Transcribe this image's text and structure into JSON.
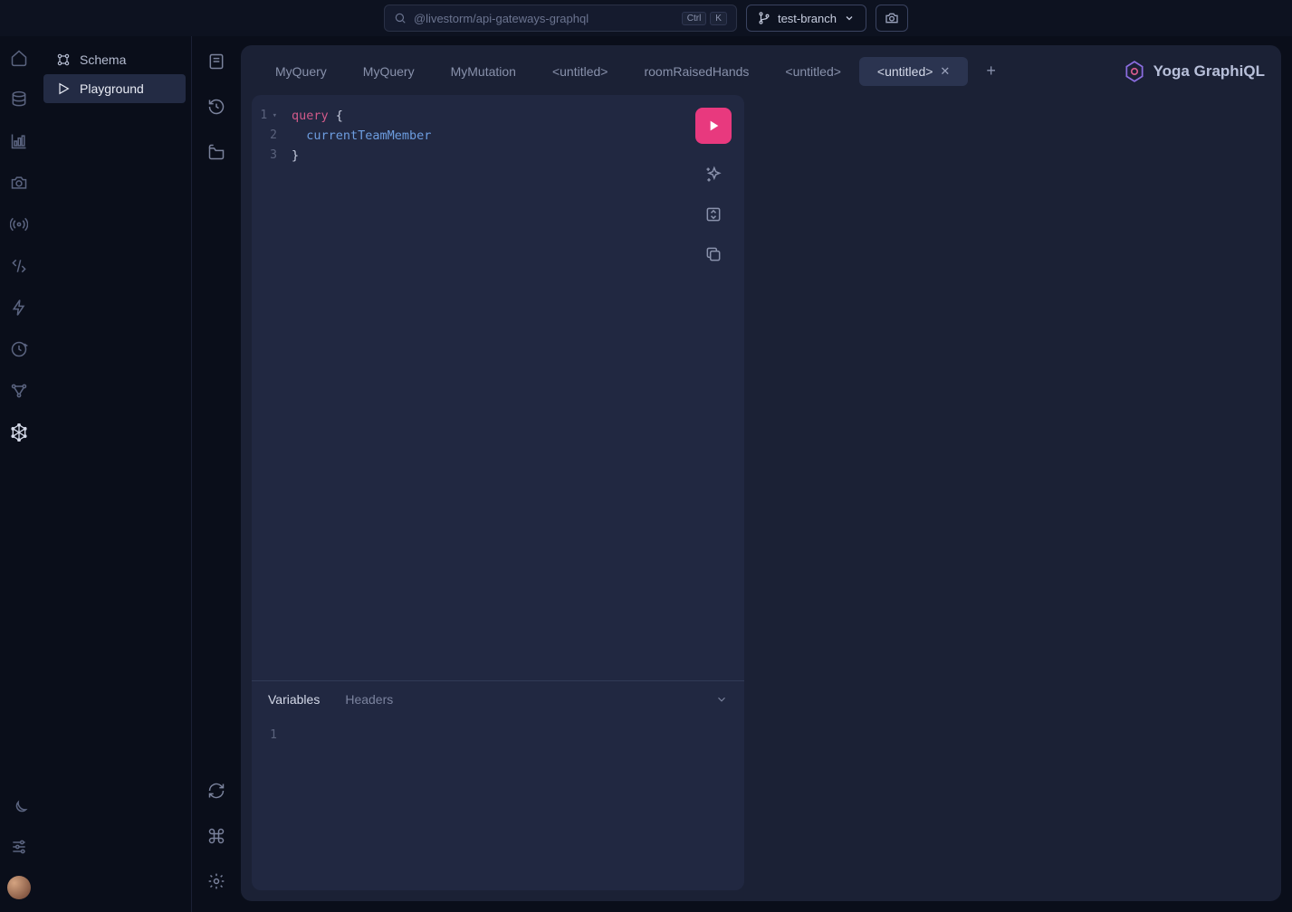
{
  "topbar": {
    "search_text": "@livestorm/api-gateways-graphql",
    "kbd1": "Ctrl",
    "kbd2": "K",
    "branch_label": "test-branch"
  },
  "sidebar2": {
    "items": [
      {
        "label": "Schema"
      },
      {
        "label": "Playground"
      }
    ]
  },
  "tabs": [
    {
      "label": "MyQuery"
    },
    {
      "label": "MyQuery"
    },
    {
      "label": "MyMutation"
    },
    {
      "label": "<untitled>"
    },
    {
      "label": "roomRaisedHands"
    },
    {
      "label": "<untitled>"
    },
    {
      "label": "<untitled>"
    }
  ],
  "brand": {
    "label": "Yoga GraphiQL"
  },
  "editor": {
    "lines": {
      "l1": "1",
      "l2": "2",
      "l3": "3"
    },
    "kw_query": "query",
    "brace_open": "{",
    "field": "currentTeamMember",
    "brace_close": "}"
  },
  "varpanel": {
    "tab_variables": "Variables",
    "tab_headers": "Headers",
    "line1": "1"
  }
}
